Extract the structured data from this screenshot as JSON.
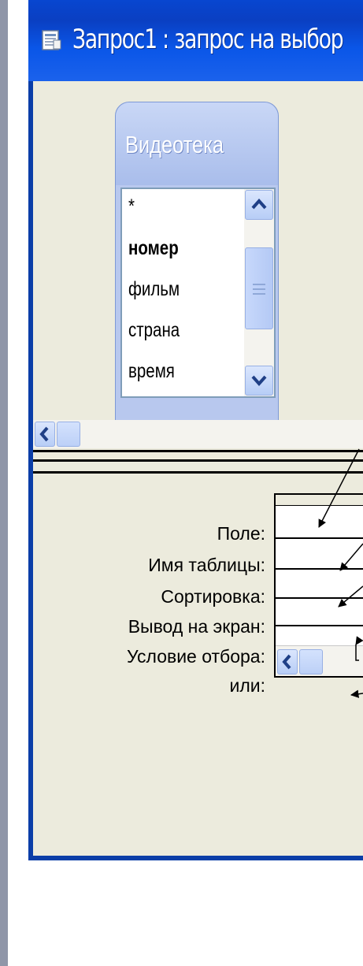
{
  "window": {
    "title": "Запрос1 : запрос на выбор",
    "icon": "query-icon"
  },
  "table": {
    "name": "Видеотека",
    "fields": [
      {
        "label": "*",
        "bold": false
      },
      {
        "label": "номер",
        "bold": true
      },
      {
        "label": "фильм",
        "bold": false
      },
      {
        "label": "страна",
        "bold": false
      },
      {
        "label": "время",
        "bold": false
      }
    ]
  },
  "grid": {
    "rows": [
      {
        "label": "Поле:"
      },
      {
        "label": "Имя таблицы:"
      },
      {
        "label": "Сортировка:"
      },
      {
        "label": "Вывод на экран:"
      },
      {
        "label": "Условие отбора:"
      },
      {
        "label": "или:"
      }
    ]
  },
  "colors": {
    "titlebar": "#0a56e8",
    "background": "#ecebdd",
    "accent": "#b8c8ee"
  }
}
